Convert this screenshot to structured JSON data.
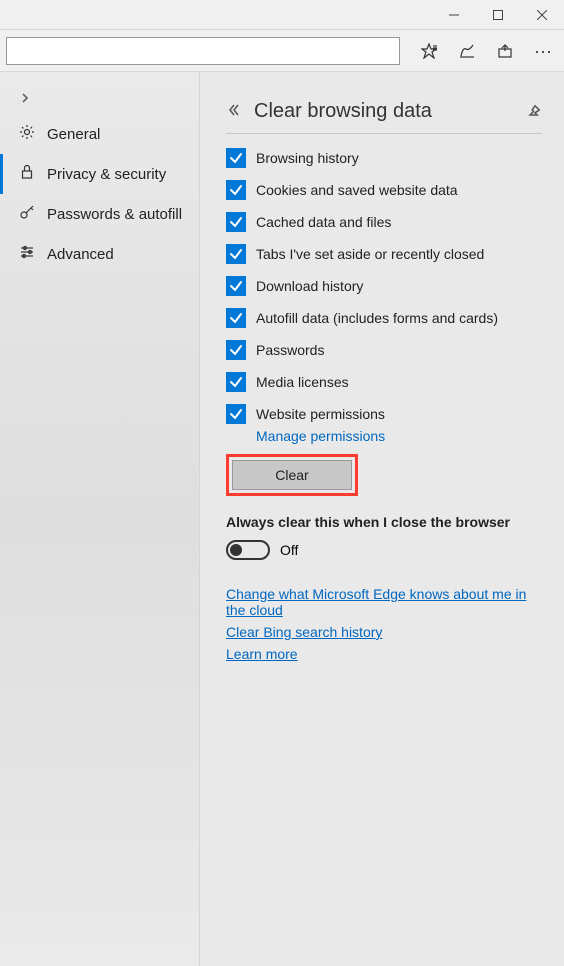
{
  "sidebar": {
    "items": [
      {
        "label": "General"
      },
      {
        "label": "Privacy & security"
      },
      {
        "label": "Passwords & autofill"
      },
      {
        "label": "Advanced"
      }
    ]
  },
  "panel": {
    "title": "Clear browsing data",
    "checks": [
      {
        "label": "Browsing history"
      },
      {
        "label": "Cookies and saved website data"
      },
      {
        "label": "Cached data and files"
      },
      {
        "label": "Tabs I've set aside or recently closed"
      },
      {
        "label": "Download history"
      },
      {
        "label": "Autofill data (includes forms and cards)"
      },
      {
        "label": "Passwords"
      },
      {
        "label": "Media licenses"
      },
      {
        "label": "Website permissions"
      }
    ],
    "manage_permissions": "Manage permissions",
    "clear_label": "Clear",
    "always_header": "Always clear this when I close the browser",
    "toggle_state": "Off",
    "links": {
      "cloud": "Change what Microsoft Edge knows about me in the cloud",
      "bing": "Clear Bing search history",
      "learn": "Learn more"
    }
  }
}
